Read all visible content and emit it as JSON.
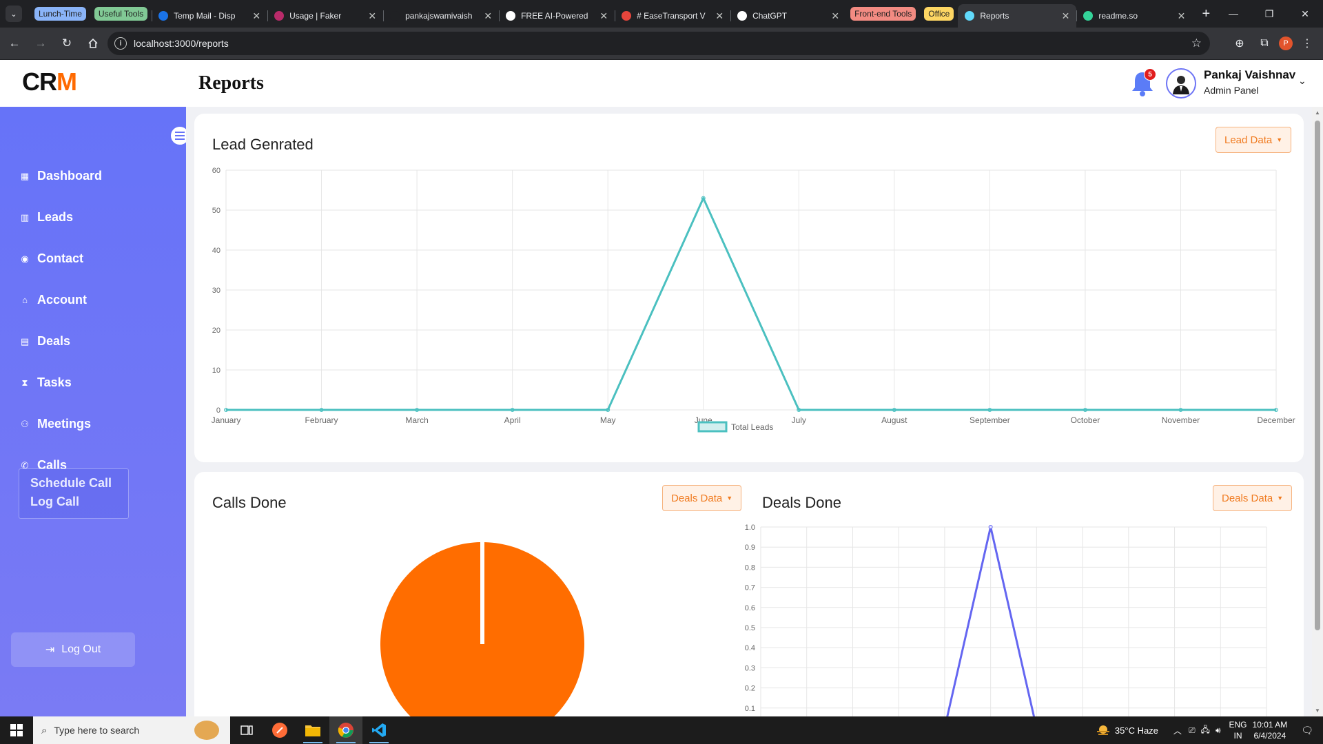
{
  "browser": {
    "tab_search_icon": "chevron-down-icon",
    "tabs": [
      {
        "kind": "group",
        "label": "Lunch-Time",
        "color": "#8ab4f8"
      },
      {
        "kind": "group",
        "label": "Useful Tools",
        "color": "#81c995"
      },
      {
        "kind": "tab",
        "label": "Temp Mail - Disp",
        "icon": "globe-icon",
        "favicon_color": "#1a73e8"
      },
      {
        "kind": "tab",
        "label": "Usage | Faker",
        "icon": "faker-icon",
        "favicon_color": "#b92b6a"
      },
      {
        "kind": "tab",
        "label": "pankajswamivaish",
        "icon": "github-icon",
        "favicon_color": "#202124"
      },
      {
        "kind": "tab",
        "label": "FREE AI-Powered",
        "icon": "w-icon",
        "favicon_color": "#ffffff"
      },
      {
        "kind": "tab",
        "label": "# EaseTransport V",
        "icon": "ease-icon",
        "favicon_color": "#e8453c"
      },
      {
        "kind": "tab",
        "label": "ChatGPT",
        "icon": "chatgpt-icon",
        "favicon_color": "#ffffff"
      },
      {
        "kind": "group",
        "label": "Front-end Tools",
        "color": "#f28b82"
      },
      {
        "kind": "group",
        "label": "Office",
        "color": "#fdd663"
      },
      {
        "kind": "tab",
        "label": "Reports",
        "icon": "react-icon",
        "favicon_color": "#61dafb",
        "active": true
      },
      {
        "kind": "tab",
        "label": "readme.so",
        "icon": "readme-icon",
        "favicon_color": "#34d399"
      }
    ],
    "url": "localhost:3000/reports"
  },
  "header": {
    "logo_main": "CR",
    "logo_accent": "M",
    "page_title": "Reports",
    "notification_count": "5",
    "user_name": "Pankaj Vaishnav",
    "user_role": "Admin Panel"
  },
  "sidebar": {
    "items": [
      {
        "label": "Dashboard",
        "icon": "dashboard-icon"
      },
      {
        "label": "Leads",
        "icon": "chart-icon"
      },
      {
        "label": "Contact",
        "icon": "contact-icon"
      },
      {
        "label": "Account",
        "icon": "bank-icon"
      },
      {
        "label": "Deals",
        "icon": "document-icon"
      },
      {
        "label": "Tasks",
        "icon": "hourglass-icon"
      },
      {
        "label": "Meetings",
        "icon": "people-icon"
      },
      {
        "label": "Calls",
        "icon": "phone-icon"
      }
    ],
    "calls_submenu": [
      "Schedule Call",
      "Log Call"
    ],
    "logout_label": "Log Out"
  },
  "cards": {
    "lead": {
      "title": "Lead Genrated",
      "button": "Lead Data"
    },
    "calls": {
      "title": "Calls Done",
      "button": "Deals Data"
    },
    "deals": {
      "title": "Deals Done",
      "button": "Deals Data"
    }
  },
  "chart_data": [
    {
      "type": "line",
      "title": "Lead Genrated",
      "categories": [
        "January",
        "February",
        "March",
        "April",
        "May",
        "June",
        "July",
        "August",
        "September",
        "October",
        "November",
        "December"
      ],
      "series": [
        {
          "name": "Total Leads",
          "values": [
            0,
            0,
            0,
            0,
            0,
            53,
            0,
            0,
            0,
            0,
            0,
            0
          ],
          "color": "#4bc0c0"
        }
      ],
      "ylim": [
        0,
        60
      ],
      "yticks": [
        0,
        10,
        20,
        30,
        40,
        50,
        60
      ],
      "grid": true,
      "legend": "bottom"
    },
    {
      "type": "pie",
      "title": "Calls Done",
      "slices": [
        {
          "value": 99.7,
          "color": "#ff6d00"
        },
        {
          "value": 0.3,
          "color": "#ffffff"
        }
      ]
    },
    {
      "type": "line",
      "title": "Deals Done",
      "categories": [
        "",
        "",
        "",
        "",
        "",
        "",
        "",
        "",
        "",
        "",
        "",
        ""
      ],
      "series": [
        {
          "values": [
            0,
            0,
            0,
            0,
            0,
            1.0,
            0,
            0,
            0,
            0,
            0,
            0
          ],
          "color": "#6466f1"
        }
      ],
      "ylim": [
        0,
        1.0
      ],
      "yticks": [
        0.1,
        0.2,
        0.3,
        0.4,
        0.5,
        0.6,
        0.7,
        0.8,
        0.9,
        1.0
      ],
      "grid": true
    }
  ],
  "taskbar": {
    "search_placeholder": "Type here to search",
    "weather": "35°C  Haze",
    "lang_top": "ENG",
    "lang_bottom": "IN",
    "time": "10:01 AM",
    "date": "6/4/2024"
  }
}
